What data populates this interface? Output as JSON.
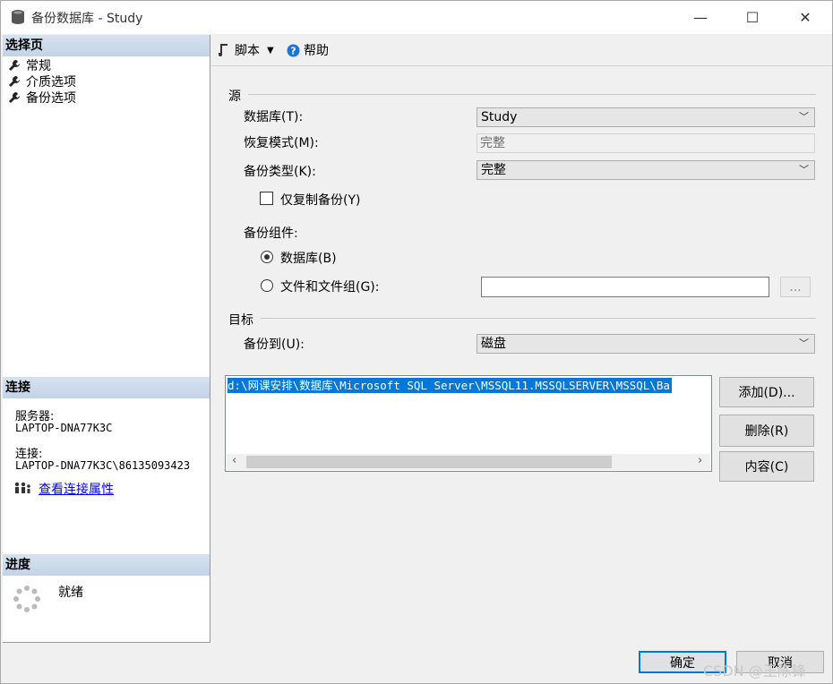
{
  "window": {
    "title": "备份数据库 - Study",
    "minimize": "—",
    "maximize": "☐",
    "close": "✕"
  },
  "sidebar": {
    "select_page_header": "选择页",
    "pages": [
      "常规",
      "介质选项",
      "备份选项"
    ],
    "connection_header": "连接",
    "server_label": "服务器:",
    "server_value": "LAPTOP-DNA77K3C",
    "connection_label": "连接:",
    "connection_value": "LAPTOP-DNA77K3C\\86135093423",
    "view_connection_link": "查看连接属性",
    "progress_header": "进度",
    "progress_status": "就绪"
  },
  "toolbar": {
    "script_label": "脚本",
    "help_label": "帮助"
  },
  "source": {
    "group_label": "源",
    "database_label": "数据库(T):",
    "database_value": "Study",
    "recovery_label": "恢复模式(M):",
    "recovery_value": "完整",
    "backup_type_label": "备份类型(K):",
    "backup_type_value": "完整",
    "copy_only_label": "仅复制备份(Y)",
    "copy_only_checked": false,
    "component_label": "备份组件:",
    "component_database_label": "数据库(B)",
    "component_files_label": "文件和文件组(G):",
    "selected_component": "database",
    "browse_label": "..."
  },
  "destination": {
    "group_label": "目标",
    "backup_to_label": "备份到(U):",
    "backup_to_value": "磁盘",
    "paths": [
      "d:\\网课安排\\数据库\\Microsoft SQL Server\\MSSQL11.MSSQLSERVER\\MSSQL\\Ba"
    ],
    "add_label": "添加(D)...",
    "remove_label": "删除(R)",
    "contents_label": "内容(C)"
  },
  "footer": {
    "ok_label": "确定",
    "cancel_label": "取消",
    "watermark": "CSDN @王陈锋"
  }
}
